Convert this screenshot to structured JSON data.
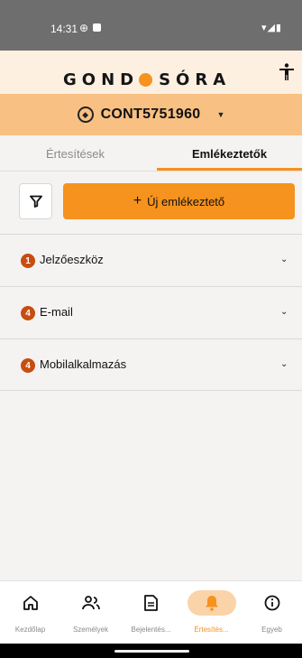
{
  "status_bar": {
    "time": "14:31",
    "icons_right": "▾◢▮"
  },
  "header": {
    "logo_left": "GOND",
    "logo_right": "SÓRA",
    "accessibility_icon": "accessibility-icon"
  },
  "device": {
    "id": "CONT5751960"
  },
  "tabs": [
    {
      "label": "Értesítések",
      "active": false
    },
    {
      "label": "Emlékeztetők",
      "active": true
    }
  ],
  "actions": {
    "new_reminder": "Új emlékeztető",
    "plus": "+"
  },
  "sections": [
    {
      "count": "1",
      "title": "Jelzőeszköz"
    },
    {
      "count": "4",
      "title": "E-mail"
    },
    {
      "count": "4",
      "title": "Mobilalkalmazás"
    }
  ],
  "nav": [
    {
      "label": "Kezdőlap",
      "icon": "home-icon",
      "active": false
    },
    {
      "label": "Személyek",
      "icon": "people-icon",
      "active": false
    },
    {
      "label": "Bejelentés...",
      "icon": "document-icon",
      "active": false
    },
    {
      "label": "Értesítés...",
      "icon": "bell-icon",
      "active": true
    },
    {
      "label": "Egyeb",
      "icon": "info-icon",
      "active": false
    }
  ],
  "colors": {
    "accent": "#f6921e",
    "badge": "#c74d10",
    "header_bg": "#fdf0e1",
    "device_bar": "#f9c083"
  }
}
